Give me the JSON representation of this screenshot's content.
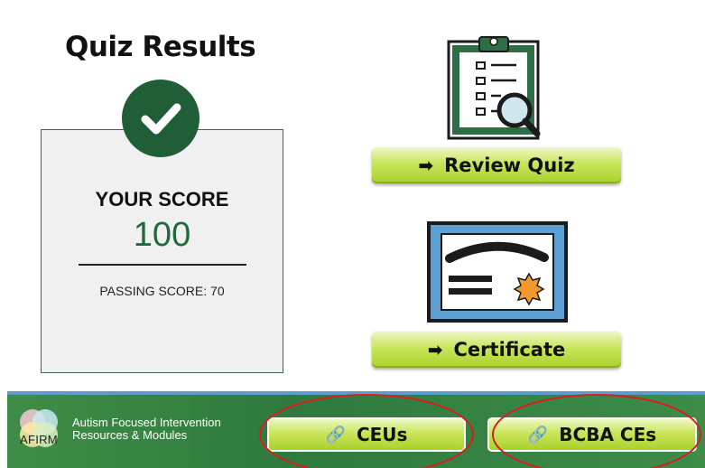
{
  "title": "Quiz Results",
  "score": {
    "label": "YOUR SCORE",
    "value": "100",
    "passing": "PASSING SCORE: 70"
  },
  "actions": {
    "review_label": "Review Quiz",
    "certificate_label": "Certificate"
  },
  "footer": {
    "logo_text": "AFIRM",
    "org_name_line1": "Autism Focused Intervention",
    "org_name_line2": "Resources & Modules",
    "ceus_label": "CEUs",
    "bcba_label": "BCBA CEs"
  },
  "colors": {
    "primary_green": "#1f5e37",
    "button_green": "#c9e55a",
    "footer_green": "#3f8d46",
    "annotation_red": "#d42020"
  },
  "icons": [
    "check-icon",
    "clipboard-magnifier-icon",
    "certificate-icon",
    "arrow-right-icon",
    "link-icon"
  ]
}
